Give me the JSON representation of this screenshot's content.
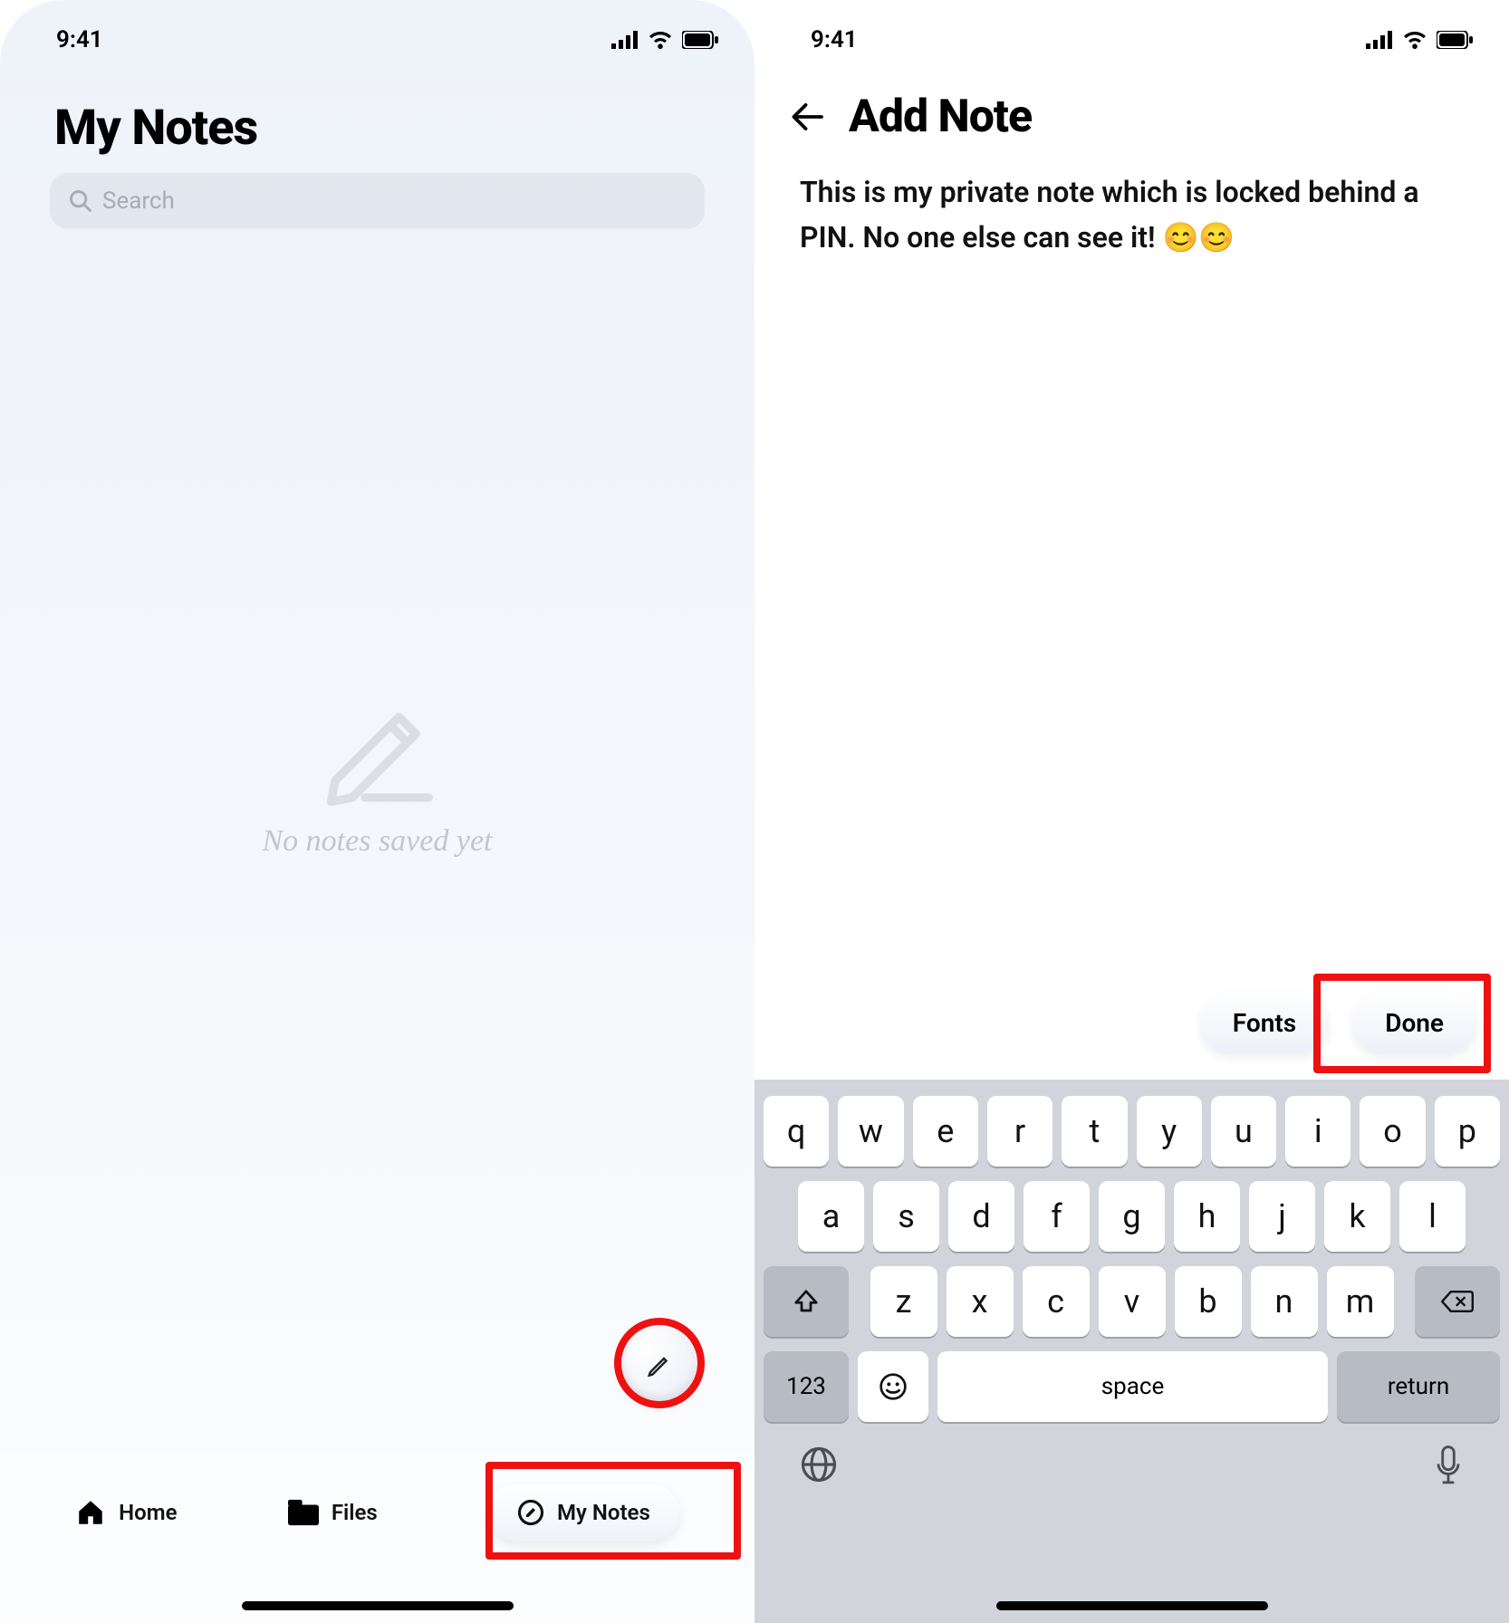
{
  "status": {
    "time": "9:41"
  },
  "left": {
    "title": "My Notes",
    "search_placeholder": "Search",
    "empty_text": "No notes saved yet",
    "fab_icon": "edit-pencil-icon",
    "nav": {
      "home": "Home",
      "files": "Files",
      "notes": "My Notes"
    }
  },
  "right": {
    "title": "Add Note",
    "note_text": "This is my private note which is locked behind a PIN. No one else can see it! 😊😊",
    "fonts_label": "Fonts",
    "done_label": "Done"
  },
  "keyboard": {
    "row1": [
      "q",
      "w",
      "e",
      "r",
      "t",
      "y",
      "u",
      "i",
      "o",
      "p"
    ],
    "row2": [
      "a",
      "s",
      "d",
      "f",
      "g",
      "h",
      "j",
      "k",
      "l"
    ],
    "row3": [
      "z",
      "x",
      "c",
      "v",
      "b",
      "n",
      "m"
    ],
    "shift_icon": "shift-icon",
    "backspace_icon": "backspace-icon",
    "num_label": "123",
    "emoji_icon": "emoji-icon",
    "space_label": "space",
    "return_label": "return",
    "globe_icon": "globe-icon",
    "mic_icon": "mic-icon"
  },
  "highlights": [
    "fab-button",
    "nav-notes-tab",
    "done-button"
  ]
}
